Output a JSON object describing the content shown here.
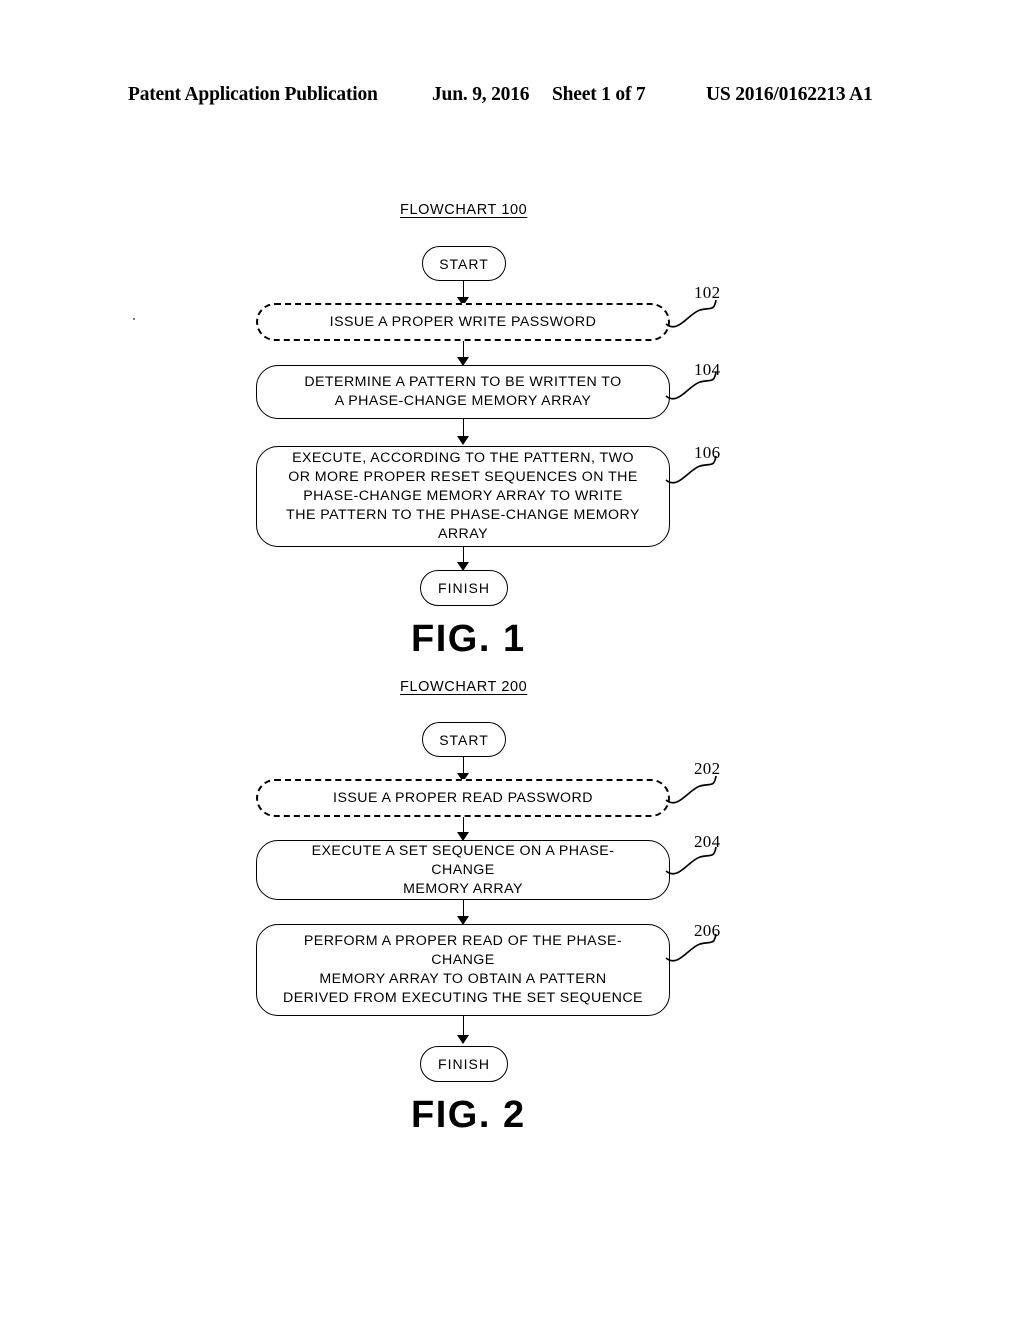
{
  "header": {
    "publication": "Patent Application Publication",
    "date": "Jun. 9, 2016",
    "sheet": "Sheet 1 of 7",
    "patent_number": "US 2016/0162213 A1"
  },
  "figures": [
    {
      "title": "FLOWCHART 100",
      "caption": "FIG. 1",
      "start_label": "START",
      "finish_label": "FINISH",
      "steps": [
        {
          "ref": "102",
          "text": "ISSUE A PROPER WRITE PASSWORD",
          "style": "dashed"
        },
        {
          "ref": "104",
          "text": "DETERMINE A PATTERN TO BE WRITTEN TO\nA PHASE-CHANGE MEMORY ARRAY",
          "style": "solid"
        },
        {
          "ref": "106",
          "text": "EXECUTE, ACCORDING TO THE PATTERN, TWO\nOR MORE PROPER RESET SEQUENCES ON THE\nPHASE-CHANGE MEMORY ARRAY TO WRITE\nTHE PATTERN TO THE PHASE-CHANGE MEMORY\nARRAY",
          "style": "solid"
        }
      ]
    },
    {
      "title": "FLOWCHART 200",
      "caption": "FIG. 2",
      "start_label": "START",
      "finish_label": "FINISH",
      "steps": [
        {
          "ref": "202",
          "text": "ISSUE A PROPER READ PASSWORD",
          "style": "dashed"
        },
        {
          "ref": "204",
          "text": "EXECUTE A SET SEQUENCE ON A PHASE-CHANGE\nMEMORY ARRAY",
          "style": "solid"
        },
        {
          "ref": "206",
          "text": "PERFORM A PROPER READ OF THE PHASE-CHANGE\nMEMORY ARRAY TO OBTAIN A PATTERN\nDERIVED FROM EXECUTING THE SET SEQUENCE",
          "style": "solid"
        }
      ]
    }
  ],
  "colors": {
    "ink": "#000000",
    "page": "#ffffff"
  }
}
